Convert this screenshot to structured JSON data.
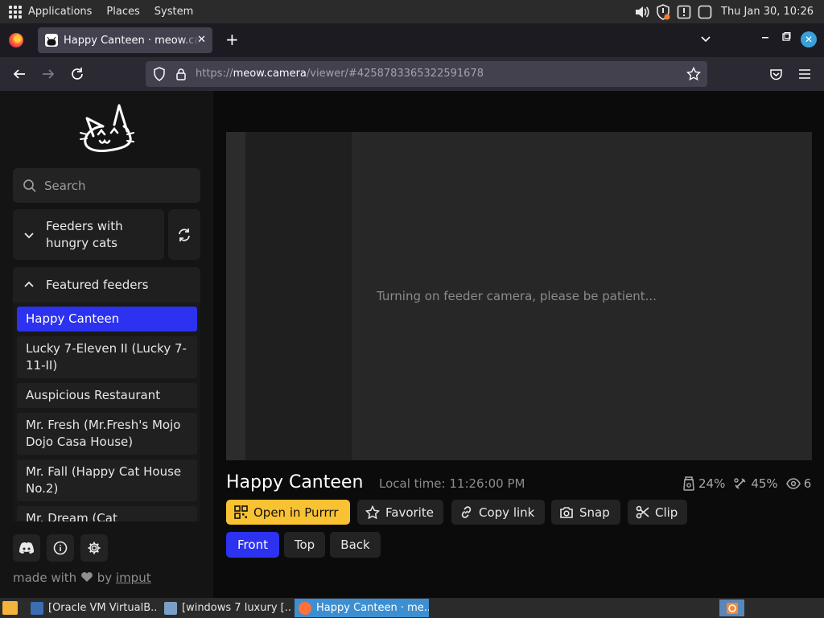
{
  "system_panel": {
    "menus": [
      "Applications",
      "Places",
      "System"
    ],
    "clock": "Thu Jan 30, 10:26"
  },
  "browser": {
    "tab_title": "Happy Canteen · meow.camera",
    "url_prefix": "https://",
    "url_host": "meow.camera",
    "url_path": "/viewer/#4258783365322591678"
  },
  "sidebar": {
    "search_placeholder": "Search",
    "group_hungry_label": "Feeders with hungry cats",
    "group_featured_label": "Featured feeders",
    "feeders": [
      {
        "label": "Happy Canteen",
        "active": true
      },
      {
        "label": "Lucky 7-Eleven II (Lucky 7-11-II)",
        "active": false
      },
      {
        "label": "Auspicious Restaurant",
        "active": false
      },
      {
        "label": "Mr. Fresh (Mr.Fresh's Mojo Dojo Casa House)",
        "active": false
      },
      {
        "label": "Mr. Fall (Happy Cat House No.2)",
        "active": false
      },
      {
        "label": "Mr. Dream (Cat Prostheses)",
        "active": false
      }
    ],
    "made_with_prefix": "made with",
    "made_with_by": "by",
    "made_with_author": "imput"
  },
  "viewer": {
    "status_message": "Turning on feeder camera, please be patient...",
    "feeder_name": "Happy Canteen",
    "local_time": "Local time: 11:26:00 PM",
    "stats": {
      "food": "24%",
      "snack": "45%",
      "viewers": "6"
    },
    "actions": [
      "Open in Purrrr",
      "Favorite",
      "Copy link",
      "Snap",
      "Clip"
    ],
    "cameras": [
      {
        "label": "Front",
        "active": true
      },
      {
        "label": "Top",
        "active": false
      },
      {
        "label": "Back",
        "active": false
      }
    ]
  },
  "taskbar": {
    "tasks": [
      {
        "label": "[Oracle VM VirtualB...",
        "active": false
      },
      {
        "label": "[windows 7 luxury [...",
        "active": false
      },
      {
        "label": "Happy Canteen · me...",
        "active": true
      }
    ]
  },
  "colors": {
    "accent_blue": "#2c32f0",
    "primary_yellow": "#f8c233",
    "firefox_close": "#3aa0d8"
  }
}
